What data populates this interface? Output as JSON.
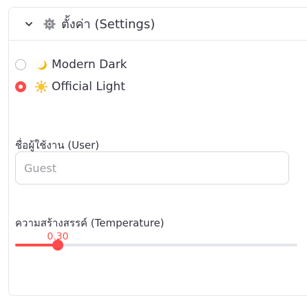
{
  "header": {
    "title": "ตั้งค่า (Settings)",
    "chevron_icon": "chevron-down-icon",
    "settings_icon": "gear-icon"
  },
  "theme": {
    "options": [
      {
        "label": "Modern Dark",
        "icon": "crescent-moon-icon",
        "selected": false
      },
      {
        "label": "Official Light",
        "icon": "sun-icon",
        "selected": true
      }
    ]
  },
  "user": {
    "label": "ชื่อผู้ใช้งาน (User)",
    "value": "",
    "placeholder": "Guest"
  },
  "temperature": {
    "label": "ความสร้างสรรค์ (Temperature)",
    "value_text": "0.30",
    "value": 0.3,
    "min": 0,
    "max": 1
  },
  "colors": {
    "accent": "#ff4b4b",
    "text": "#31333f",
    "border": "#e6e6ea"
  }
}
